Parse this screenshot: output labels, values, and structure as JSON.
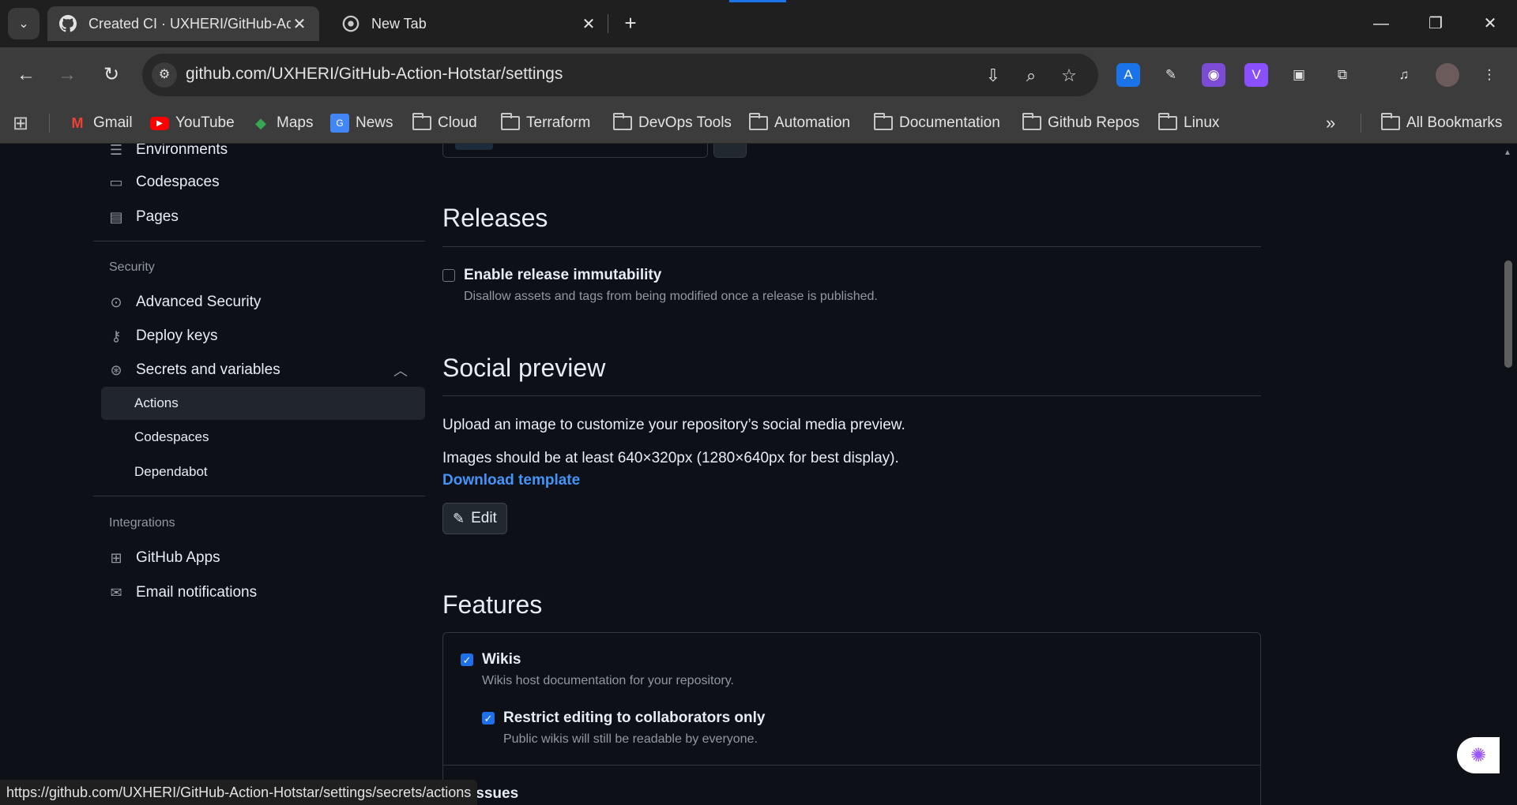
{
  "browser": {
    "tabs": [
      {
        "title": "Created CI · UXHERI/GitHub-Ac",
        "active": true,
        "icon": "github-icon"
      },
      {
        "title": "New Tab",
        "active": false,
        "icon": "chrome-icon"
      }
    ],
    "url": "github.com/UXHERI/GitHub-Action-Hotstar/settings",
    "bookmarks": [
      {
        "label": "Gmail",
        "icon": "gmail-icon"
      },
      {
        "label": "YouTube",
        "icon": "youtube-icon"
      },
      {
        "label": "Maps",
        "icon": "maps-icon"
      },
      {
        "label": "News",
        "icon": "news-icon"
      },
      {
        "label": "Cloud",
        "icon": "folder-icon"
      },
      {
        "label": "Terraform",
        "icon": "folder-icon"
      },
      {
        "label": "DevOps Tools",
        "icon": "folder-icon"
      },
      {
        "label": "Automation",
        "icon": "folder-icon"
      },
      {
        "label": "Documentation",
        "icon": "folder-icon"
      },
      {
        "label": "Github Repos",
        "icon": "folder-icon"
      },
      {
        "label": "Linux",
        "icon": "folder-icon"
      }
    ],
    "all_bookmarks": "All Bookmarks",
    "status_url": "https://github.com/UXHERI/GitHub-Action-Hotstar/settings/secrets/actions"
  },
  "sidebar": {
    "top_items": [
      {
        "label": "Environments",
        "icon": "server-icon"
      },
      {
        "label": "Codespaces",
        "icon": "codespaces-icon"
      },
      {
        "label": "Pages",
        "icon": "browser-icon"
      }
    ],
    "security_heading": "Security",
    "security_items": [
      {
        "label": "Advanced Security",
        "icon": "codescan-icon"
      },
      {
        "label": "Deploy keys",
        "icon": "key-icon"
      },
      {
        "label": "Secrets and variables",
        "icon": "asterisk-icon"
      }
    ],
    "secrets_sub": [
      "Actions",
      "Codespaces",
      "Dependabot"
    ],
    "integrations_heading": "Integrations",
    "integration_items": [
      {
        "label": "GitHub Apps",
        "icon": "apps-icon"
      },
      {
        "label": "Email notifications",
        "icon": "mail-icon"
      }
    ]
  },
  "main": {
    "releases": {
      "title": "Releases",
      "checkbox_label": "Enable release immutability",
      "checkbox_checked": false,
      "description": "Disallow assets and tags from being modified once a release is published."
    },
    "social": {
      "title": "Social preview",
      "line1": "Upload an image to customize your repository’s social media preview.",
      "line2": "Images should be at least 640×320px (1280×640px for best display).",
      "link": "Download template",
      "edit": "Edit"
    },
    "features": {
      "title": "Features",
      "wikis_label": "Wikis",
      "wikis_checked": true,
      "wikis_desc": "Wikis host documentation for your repository.",
      "restrict_label": "Restrict editing to collaborators only",
      "restrict_checked": true,
      "restrict_desc": "Public wikis will still be readable by everyone.",
      "issues_label": "Issues"
    }
  }
}
